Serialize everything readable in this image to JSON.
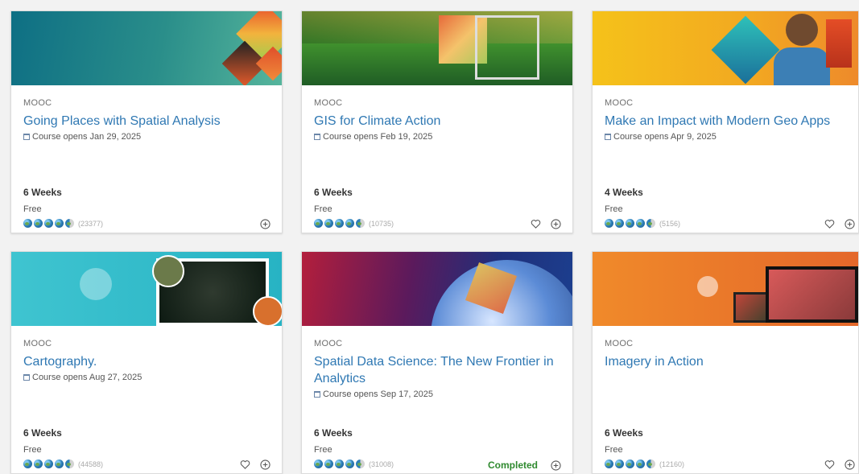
{
  "cards": [
    {
      "type": "MOOC",
      "title_lines": [
        "Going Places with Spatial Analysis",
        ""
      ],
      "opens": "Course opens Jan 29, 2025",
      "duration": "6 Weeks",
      "price": "Free",
      "rating_count": "(23377)",
      "completed": ""
    },
    {
      "type": "MOOC",
      "title_lines": [
        "GIS for Climate Action",
        ""
      ],
      "opens": "Course opens Feb 19, 2025",
      "duration": "6 Weeks",
      "price": "Free",
      "rating_count": "(10735)",
      "completed": ""
    },
    {
      "type": "MOOC",
      "title_lines": [
        "Make an Impact with Modern Geo Apps",
        ""
      ],
      "opens": "Course opens Apr 9, 2025",
      "duration": "4 Weeks",
      "price": "Free",
      "rating_count": "(5156)",
      "completed": ""
    },
    {
      "type": "MOOC",
      "title_lines": [
        "Cartography.",
        ""
      ],
      "opens": "Course opens Aug 27, 2025",
      "duration": "6 Weeks",
      "price": "Free",
      "rating_count": "(44588)",
      "completed": ""
    },
    {
      "type": "MOOC",
      "title_lines": [
        "Spatial Data Science: The New Frontier in",
        "Analytics"
      ],
      "opens": "Course opens Sep 17, 2025",
      "duration": "6 Weeks",
      "price": "Free",
      "rating_count": "(31008)",
      "completed": "Completed"
    },
    {
      "type": "MOOC",
      "title_lines": [
        "Imagery in Action",
        ""
      ],
      "opens": "",
      "duration": "6 Weeks",
      "price": "Free",
      "rating_count": "(12160)",
      "completed": ""
    }
  ],
  "icons": {
    "calendar": "calendar-icon",
    "rating": "globe-rating-icon",
    "favorite": "heart-icon",
    "add": "plus-circle-icon"
  }
}
